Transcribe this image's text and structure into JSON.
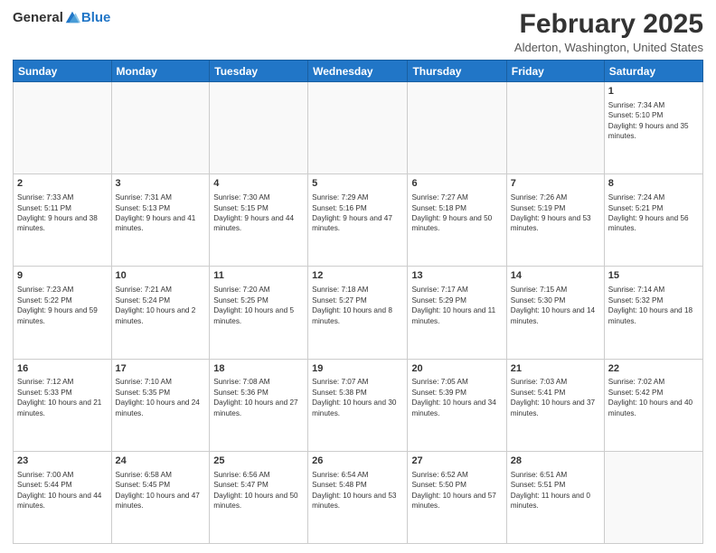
{
  "header": {
    "logo_general": "General",
    "logo_blue": "Blue",
    "month_year": "February 2025",
    "location": "Alderton, Washington, United States"
  },
  "weekdays": [
    "Sunday",
    "Monday",
    "Tuesday",
    "Wednesday",
    "Thursday",
    "Friday",
    "Saturday"
  ],
  "weeks": [
    [
      {
        "day": "",
        "info": ""
      },
      {
        "day": "",
        "info": ""
      },
      {
        "day": "",
        "info": ""
      },
      {
        "day": "",
        "info": ""
      },
      {
        "day": "",
        "info": ""
      },
      {
        "day": "",
        "info": ""
      },
      {
        "day": "1",
        "info": "Sunrise: 7:34 AM\nSunset: 5:10 PM\nDaylight: 9 hours and 35 minutes."
      }
    ],
    [
      {
        "day": "2",
        "info": "Sunrise: 7:33 AM\nSunset: 5:11 PM\nDaylight: 9 hours and 38 minutes."
      },
      {
        "day": "3",
        "info": "Sunrise: 7:31 AM\nSunset: 5:13 PM\nDaylight: 9 hours and 41 minutes."
      },
      {
        "day": "4",
        "info": "Sunrise: 7:30 AM\nSunset: 5:15 PM\nDaylight: 9 hours and 44 minutes."
      },
      {
        "day": "5",
        "info": "Sunrise: 7:29 AM\nSunset: 5:16 PM\nDaylight: 9 hours and 47 minutes."
      },
      {
        "day": "6",
        "info": "Sunrise: 7:27 AM\nSunset: 5:18 PM\nDaylight: 9 hours and 50 minutes."
      },
      {
        "day": "7",
        "info": "Sunrise: 7:26 AM\nSunset: 5:19 PM\nDaylight: 9 hours and 53 minutes."
      },
      {
        "day": "8",
        "info": "Sunrise: 7:24 AM\nSunset: 5:21 PM\nDaylight: 9 hours and 56 minutes."
      }
    ],
    [
      {
        "day": "9",
        "info": "Sunrise: 7:23 AM\nSunset: 5:22 PM\nDaylight: 9 hours and 59 minutes."
      },
      {
        "day": "10",
        "info": "Sunrise: 7:21 AM\nSunset: 5:24 PM\nDaylight: 10 hours and 2 minutes."
      },
      {
        "day": "11",
        "info": "Sunrise: 7:20 AM\nSunset: 5:25 PM\nDaylight: 10 hours and 5 minutes."
      },
      {
        "day": "12",
        "info": "Sunrise: 7:18 AM\nSunset: 5:27 PM\nDaylight: 10 hours and 8 minutes."
      },
      {
        "day": "13",
        "info": "Sunrise: 7:17 AM\nSunset: 5:29 PM\nDaylight: 10 hours and 11 minutes."
      },
      {
        "day": "14",
        "info": "Sunrise: 7:15 AM\nSunset: 5:30 PM\nDaylight: 10 hours and 14 minutes."
      },
      {
        "day": "15",
        "info": "Sunrise: 7:14 AM\nSunset: 5:32 PM\nDaylight: 10 hours and 18 minutes."
      }
    ],
    [
      {
        "day": "16",
        "info": "Sunrise: 7:12 AM\nSunset: 5:33 PM\nDaylight: 10 hours and 21 minutes."
      },
      {
        "day": "17",
        "info": "Sunrise: 7:10 AM\nSunset: 5:35 PM\nDaylight: 10 hours and 24 minutes."
      },
      {
        "day": "18",
        "info": "Sunrise: 7:08 AM\nSunset: 5:36 PM\nDaylight: 10 hours and 27 minutes."
      },
      {
        "day": "19",
        "info": "Sunrise: 7:07 AM\nSunset: 5:38 PM\nDaylight: 10 hours and 30 minutes."
      },
      {
        "day": "20",
        "info": "Sunrise: 7:05 AM\nSunset: 5:39 PM\nDaylight: 10 hours and 34 minutes."
      },
      {
        "day": "21",
        "info": "Sunrise: 7:03 AM\nSunset: 5:41 PM\nDaylight: 10 hours and 37 minutes."
      },
      {
        "day": "22",
        "info": "Sunrise: 7:02 AM\nSunset: 5:42 PM\nDaylight: 10 hours and 40 minutes."
      }
    ],
    [
      {
        "day": "23",
        "info": "Sunrise: 7:00 AM\nSunset: 5:44 PM\nDaylight: 10 hours and 44 minutes."
      },
      {
        "day": "24",
        "info": "Sunrise: 6:58 AM\nSunset: 5:45 PM\nDaylight: 10 hours and 47 minutes."
      },
      {
        "day": "25",
        "info": "Sunrise: 6:56 AM\nSunset: 5:47 PM\nDaylight: 10 hours and 50 minutes."
      },
      {
        "day": "26",
        "info": "Sunrise: 6:54 AM\nSunset: 5:48 PM\nDaylight: 10 hours and 53 minutes."
      },
      {
        "day": "27",
        "info": "Sunrise: 6:52 AM\nSunset: 5:50 PM\nDaylight: 10 hours and 57 minutes."
      },
      {
        "day": "28",
        "info": "Sunrise: 6:51 AM\nSunset: 5:51 PM\nDaylight: 11 hours and 0 minutes."
      },
      {
        "day": "",
        "info": ""
      }
    ]
  ]
}
